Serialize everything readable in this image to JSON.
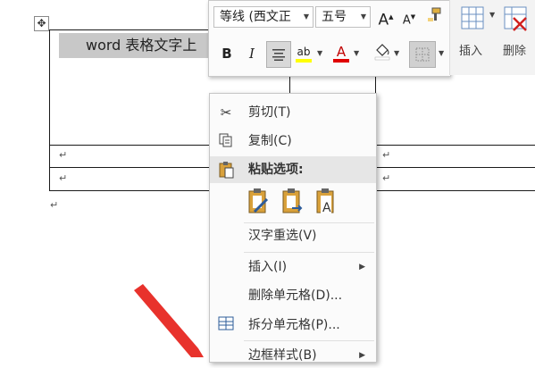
{
  "document": {
    "cell_text": "word 表格文字上",
    "move_handle_glyph": "✥",
    "paragraph_mark": "↵"
  },
  "mini_toolbar": {
    "font_name": "等线 (西文正",
    "font_size": "五号",
    "grow_font_label": "A",
    "shrink_font_label": "A",
    "bold_label": "B",
    "italic_label": "I",
    "font_color_label": "A",
    "highlight_label": "ab"
  },
  "ribbon": {
    "insert_label": "插入",
    "delete_label": "删除"
  },
  "context_menu": {
    "cut": "剪切(T)",
    "copy": "复制(C)",
    "paste_header": "粘贴选项:",
    "hanzi_reselect": "汉字重选(V)",
    "insert": "插入(I)",
    "delete_cells": "删除单元格(D)...",
    "split_cells": "拆分单元格(P)...",
    "border_styles": "边框样式(B)"
  },
  "colors": {
    "highlight_yellow": "#ffff00",
    "font_red": "#e00000",
    "arrow_red": "#e8322c",
    "paste_icon_orange": "#d9a13b",
    "paste_icon_blue": "#2e5c9a"
  }
}
